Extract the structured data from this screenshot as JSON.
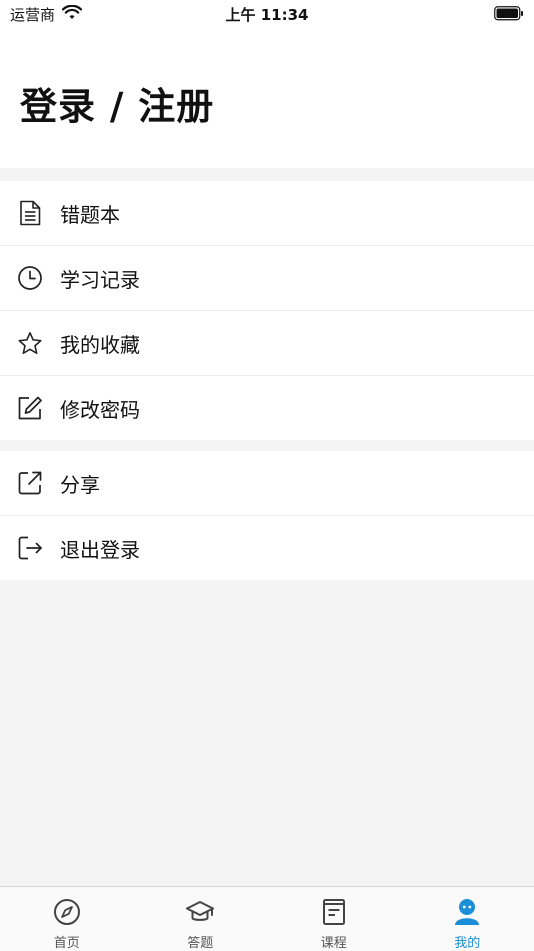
{
  "status_bar": {
    "carrier": "运营商",
    "time": "上午 11:34",
    "icons": [
      "wifi-icon",
      "battery-icon"
    ]
  },
  "header": {
    "login_title": "登录 / 注册"
  },
  "menu": {
    "group1": [
      {
        "label": "错题本",
        "icon": "document-icon"
      },
      {
        "label": "学习记录",
        "icon": "clock-icon"
      },
      {
        "label": "我的收藏",
        "icon": "star-icon"
      },
      {
        "label": "修改密码",
        "icon": "edit-icon"
      }
    ],
    "group2": [
      {
        "label": "分享",
        "icon": "share-icon"
      },
      {
        "label": "退出登录",
        "icon": "logout-icon"
      }
    ]
  },
  "tab_bar": {
    "tabs": [
      {
        "label": "首页",
        "icon": "compass-icon"
      },
      {
        "label": "答题",
        "icon": "graduation-cap-icon"
      },
      {
        "label": "课程",
        "icon": "book-icon"
      },
      {
        "label": "我的",
        "icon": "user-icon"
      }
    ],
    "active_index": 3
  },
  "colors": {
    "accent": "#1a8fd8",
    "background": "#f4f4f4",
    "text": "#111111"
  }
}
